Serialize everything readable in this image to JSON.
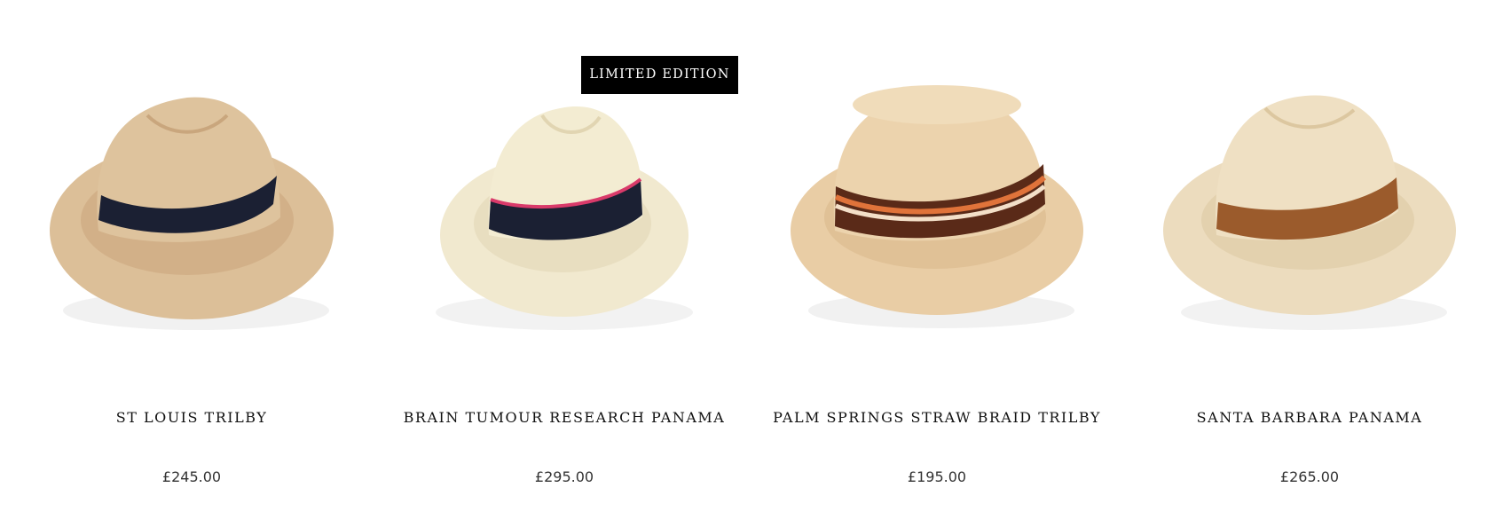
{
  "products": [
    {
      "title": "ST LOUIS TRILBY",
      "price": "£245.00",
      "image_icon": "trilby-hat-navy-band-image"
    },
    {
      "title": "BRAIN TUMOUR RESEARCH PANAMA",
      "price": "£295.00",
      "image_icon": "panama-hat-navy-pink-band-image",
      "badge": "LIMITED EDITION"
    },
    {
      "title": "PALM SPRINGS STRAW BRAID TRILBY",
      "price": "£195.00",
      "image_icon": "trilby-hat-striped-band-image"
    },
    {
      "title": "SANTA BARBARA PANAMA",
      "price": "£265.00",
      "image_icon": "panama-hat-tan-band-image"
    }
  ],
  "colors": {
    "straw_1": "#dcbf98",
    "straw_2": "#f1e9cf",
    "straw_3": "#e9cda5",
    "straw_4": "#ecdcbe",
    "band_navy": "#1b2033",
    "band_pink": "#d93a6a",
    "band_brown": "#5a2a18",
    "band_orange": "#e0733a",
    "band_tan": "#9b5b2c",
    "badge_bg": "#000000"
  }
}
